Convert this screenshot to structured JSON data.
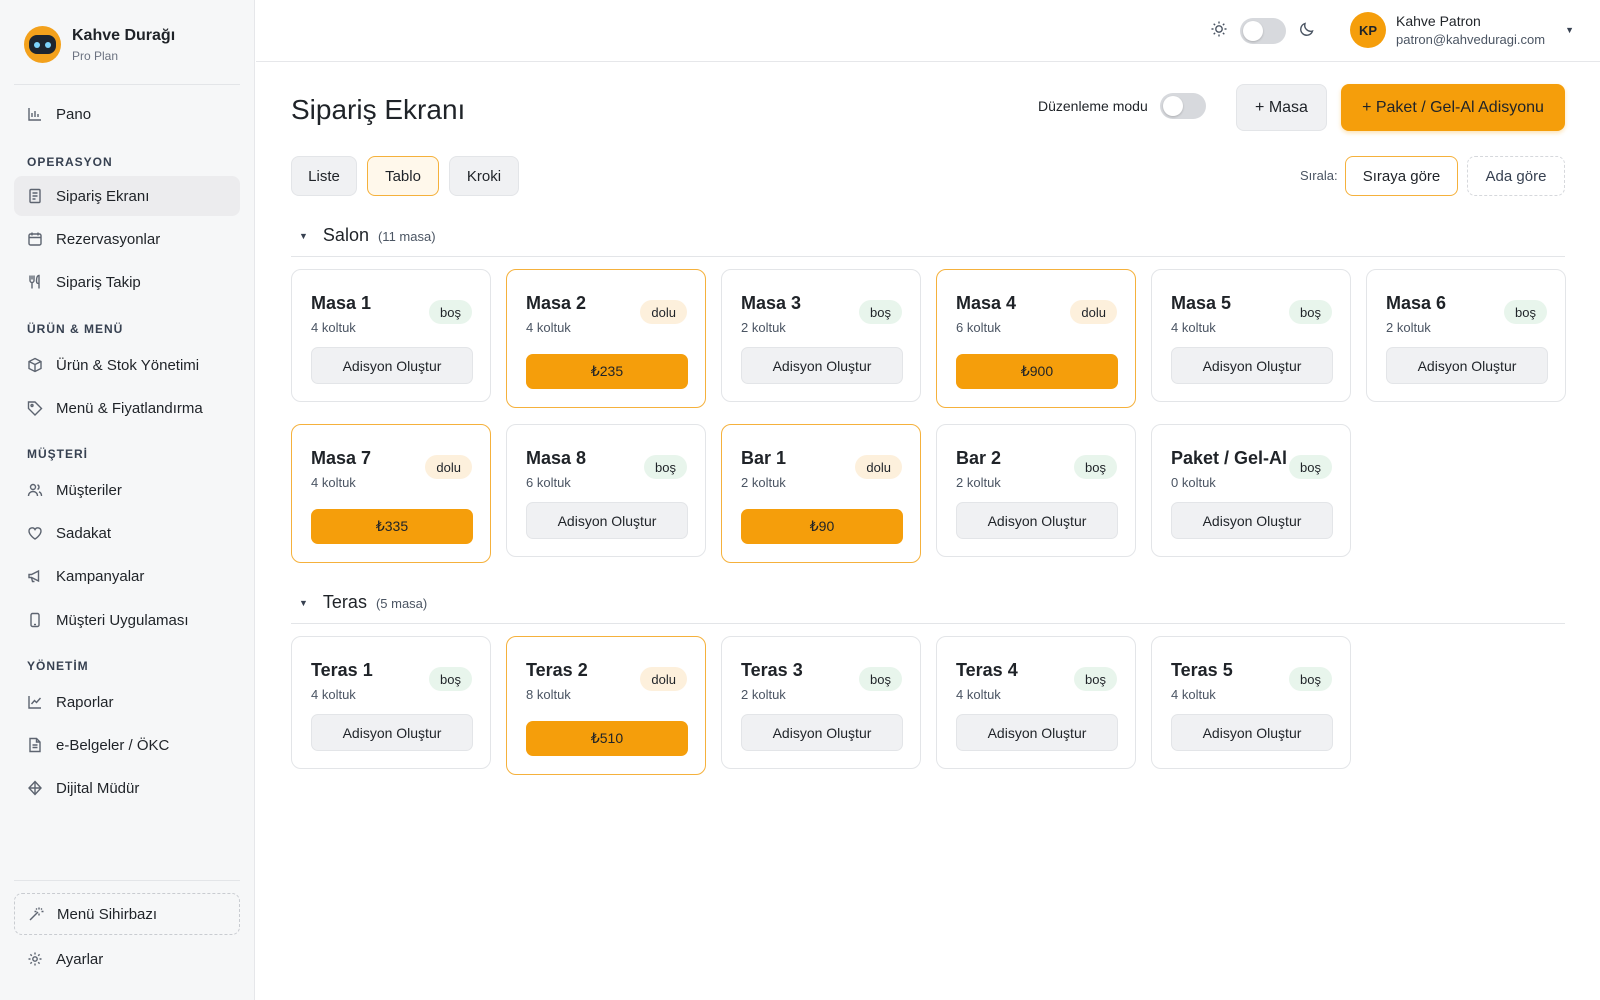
{
  "brand": {
    "name": "Kahve Durağı",
    "plan": "Pro Plan"
  },
  "sidebar": {
    "pano": "Pano",
    "sections": {
      "operasyon": "OPERASYON",
      "urun": "ÜRÜN & MENÜ",
      "musteri": "MÜŞTERİ",
      "yonetim": "YÖNETİM"
    },
    "items": {
      "siparis_ekrani": "Sipariş Ekranı",
      "rezervasyonlar": "Rezervasyonlar",
      "siparis_takip": "Sipariş Takip",
      "urun_stok": "Ürün & Stok Yönetimi",
      "menu_fiyat": "Menü & Fiyatlandırma",
      "musteriler": "Müşteriler",
      "sadakat": "Sadakat",
      "kampanyalar": "Kampanyalar",
      "musteri_uyg": "Müşteri Uygulaması",
      "raporlar": "Raporlar",
      "ebelgeler": "e-Belgeler / ÖKC",
      "dijital_mudur": "Dijital Müdür",
      "menu_sihirbazi": "Menü Sihirbazı",
      "ayarlar": "Ayarlar"
    }
  },
  "user": {
    "initials": "KP",
    "name": "Kahve Patron",
    "email": "patron@kahveduragi.com"
  },
  "header": {
    "title": "Sipariş Ekranı",
    "edit_mode": "Düzenleme modu",
    "add_table": "+ Masa",
    "add_package": "+ Paket / Gel-Al Adisyonu"
  },
  "views": {
    "liste": "Liste",
    "tablo": "Tablo",
    "kroki": "Kroki"
  },
  "sort": {
    "label": "Sırala:",
    "by_order": "Sıraya göre",
    "by_name": "Ada göre"
  },
  "salon": {
    "name": "Salon",
    "count": "(11 masa)",
    "tables": [
      {
        "name": "Masa 1",
        "seats": "4 koltuk",
        "status": "boş",
        "action": "Adisyon Oluştur"
      },
      {
        "name": "Masa 2",
        "seats": "4 koltuk",
        "status": "dolu",
        "amount": "₺235"
      },
      {
        "name": "Masa 3",
        "seats": "2 koltuk",
        "status": "boş",
        "action": "Adisyon Oluştur"
      },
      {
        "name": "Masa 4",
        "seats": "6 koltuk",
        "status": "dolu",
        "amount": "₺900"
      },
      {
        "name": "Masa 5",
        "seats": "4 koltuk",
        "status": "boş",
        "action": "Adisyon Oluştur"
      },
      {
        "name": "Masa 6",
        "seats": "2 koltuk",
        "status": "boş",
        "action": "Adisyon Oluştur"
      },
      {
        "name": "Masa 7",
        "seats": "4 koltuk",
        "status": "dolu",
        "amount": "₺335"
      },
      {
        "name": "Masa 8",
        "seats": "6 koltuk",
        "status": "boş",
        "action": "Adisyon Oluştur"
      },
      {
        "name": "Bar 1",
        "seats": "2 koltuk",
        "status": "dolu",
        "amount": "₺90"
      },
      {
        "name": "Bar 2",
        "seats": "2 koltuk",
        "status": "boş",
        "action": "Adisyon Oluştur"
      },
      {
        "name": "Paket / Gel-Al",
        "seats": "0 koltuk",
        "status": "boş",
        "action": "Adisyon Oluştur"
      }
    ]
  },
  "teras": {
    "name": "Teras",
    "count": "(5 masa)",
    "tables": [
      {
        "name": "Teras 1",
        "seats": "4 koltuk",
        "status": "boş",
        "action": "Adisyon Oluştur"
      },
      {
        "name": "Teras 2",
        "seats": "8 koltuk",
        "status": "dolu",
        "amount": "₺510"
      },
      {
        "name": "Teras 3",
        "seats": "2 koltuk",
        "status": "boş",
        "action": "Adisyon Oluştur"
      },
      {
        "name": "Teras 4",
        "seats": "4 koltuk",
        "status": "boş",
        "action": "Adisyon Oluştur"
      },
      {
        "name": "Teras 5",
        "seats": "4 koltuk",
        "status": "boş",
        "action": "Adisyon Oluştur"
      }
    ]
  },
  "colors": {
    "accent": "#f59e0b",
    "free_badge": "#e8f5ec",
    "busy_badge": "#fdf0dc"
  }
}
